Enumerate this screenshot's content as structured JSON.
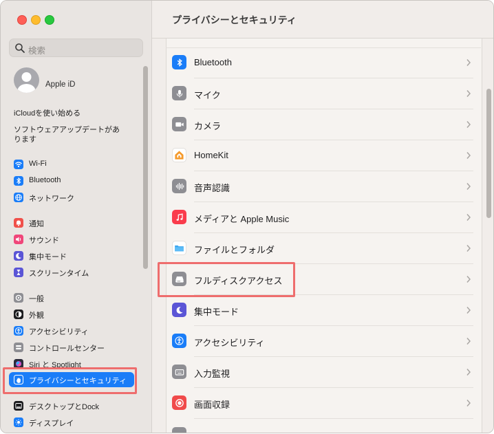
{
  "window": {
    "title": "プライバシーとセキュリティ"
  },
  "sidebar": {
    "search_placeholder": "検索",
    "apple_id": "Apple iD",
    "icloud_notice": "iCloudを使い始める",
    "update_notice": [
      "ソフトウェアアップデートがあ",
      "ります"
    ],
    "items": [
      {
        "label": "Wi-Fi",
        "icon": "wifi-icon",
        "color": "#1a7df8"
      },
      {
        "label": "Bluetooth",
        "icon": "bluetooth-icon",
        "color": "#1a7df8"
      },
      {
        "label": "ネットワーク",
        "icon": "globe-icon",
        "color": "#1a7df8"
      },
      {
        "label": "通知",
        "icon": "bell-icon",
        "color": "#f0504a"
      },
      {
        "label": "サウンド",
        "icon": "speaker-icon",
        "color": "#f0467a"
      },
      {
        "label": "集中モード",
        "icon": "moon-icon",
        "color": "#5b55d6"
      },
      {
        "label": "スクリーンタイム",
        "icon": "hourglass-icon",
        "color": "#5b55d6"
      },
      {
        "label": "一般",
        "icon": "gear-icon",
        "color": "#8e8e93"
      },
      {
        "label": "外観",
        "icon": "appearance-icon",
        "color": "#1c1c1e"
      },
      {
        "label": "アクセシビリティ",
        "icon": "accessibility-icon",
        "color": "#1a7df8"
      },
      {
        "label": "コントロールセンター",
        "icon": "control-center-icon",
        "color": "#8e8e93"
      },
      {
        "label": "Siri と Spotlight",
        "icon": "siri-icon",
        "color": "#2b2b3a"
      },
      {
        "label": "プライバシーとセキュリティ",
        "icon": "hand-icon",
        "color": "#1a7df8",
        "selected": true
      },
      {
        "label": "デスクトップとDock",
        "icon": "dock-icon",
        "color": "#1c1c1e"
      },
      {
        "label": "ディスプレイ",
        "icon": "display-icon",
        "color": "#1a7df8"
      }
    ]
  },
  "main": {
    "rows": [
      {
        "label": "Bluetooth",
        "icon": "bluetooth-icon",
        "color": "#1a7df8"
      },
      {
        "label": "マイク",
        "icon": "microphone-icon",
        "color": "#8e8e93"
      },
      {
        "label": "カメラ",
        "icon": "camera-icon",
        "color": "#8e8e93"
      },
      {
        "label": "HomeKit",
        "icon": "home-icon",
        "color": "#ffffff"
      },
      {
        "label": "音声認識",
        "icon": "waveform-icon",
        "color": "#8e8e93"
      },
      {
        "label": "メディアと Apple Music",
        "icon": "music-icon",
        "color": "#fa3c4c"
      },
      {
        "label": "ファイルとフォルダ",
        "icon": "folder-icon",
        "color": "#ffffff"
      },
      {
        "label": "フルディスクアクセス",
        "icon": "disk-icon",
        "color": "#8e8e93"
      },
      {
        "label": "集中モード",
        "icon": "moon-icon",
        "color": "#5b55d6"
      },
      {
        "label": "アクセシビリティ",
        "icon": "accessibility-icon",
        "color": "#1a7df8"
      },
      {
        "label": "入力監視",
        "icon": "keyboard-icon",
        "color": "#8e8e93"
      },
      {
        "label": "画面収録",
        "icon": "record-icon",
        "color": "#f04a4a"
      }
    ]
  },
  "highlight_color": "#ee6d6d"
}
